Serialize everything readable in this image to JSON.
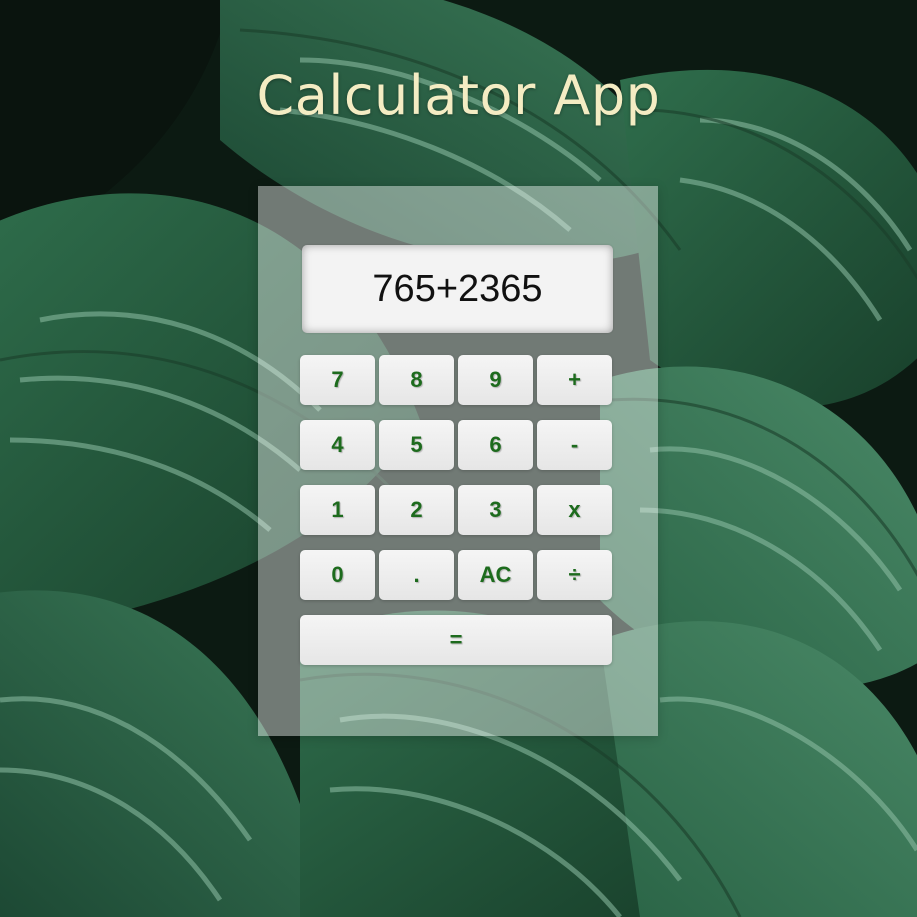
{
  "title": "Calculator App",
  "display": {
    "value": "765+2365"
  },
  "keys": {
    "row1": [
      "7",
      "8",
      "9",
      "+"
    ],
    "row2": [
      "4",
      "5",
      "6",
      "-"
    ],
    "row3": [
      "1",
      "2",
      "3",
      "x"
    ],
    "row4": [
      "0",
      ".",
      "AC",
      "÷"
    ],
    "equals": "="
  },
  "colors": {
    "title": "#f4ecc3",
    "key_text": "#1d6b1d",
    "panel": "rgba(255,255,255,0.42)",
    "leaf_dark": "#173d29",
    "leaf_mid": "#2e6b4a",
    "leaf_light": "#8fc0a6"
  }
}
